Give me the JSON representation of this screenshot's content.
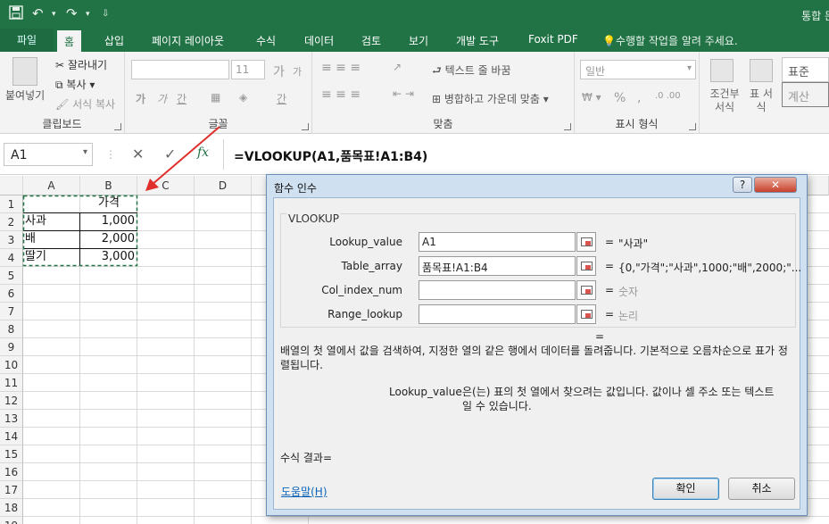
{
  "titlebar": {
    "title": "통합 문",
    "undo_icon": "undo-icon",
    "redo_icon": "redo-icon",
    "save_icon": "save-icon"
  },
  "tabs": {
    "file": "파일",
    "home": "홈",
    "insert": "삽입",
    "page_layout": "페이지 레이아웃",
    "formulas": "수식",
    "data": "데이터",
    "review": "검토",
    "view": "보기",
    "developer": "개발 도구",
    "foxit": "Foxit PDF",
    "tell_me": "수행할 작업을 알려 주세요."
  },
  "ribbon": {
    "clipboard": {
      "paste": "붙여넣기",
      "cut": "잘라내기",
      "copy": "복사",
      "format_painter": "서식 복사",
      "label": "클립보드"
    },
    "font": {
      "size": "11",
      "label": "글꼴",
      "bold": "가",
      "italic": "가",
      "underline": "간",
      "grow": "가",
      "shrink": "가",
      "font_color": "간"
    },
    "alignment": {
      "wrap": "텍스트 줄 바꿈",
      "merge": "병합하고 가운데 맞춤",
      "label": "맞춤"
    },
    "number": {
      "format": "일반",
      "percent": "%",
      "comma": ",",
      "label": "표시 형식"
    },
    "styles": {
      "conditional": "조건부 서식",
      "table": "표 서식",
      "normal": "표준",
      "calc": "계산"
    }
  },
  "formula_bar": {
    "name_box": "A1",
    "cancel": "✕",
    "enter": "✓",
    "fx": "fx",
    "formula": "=VLOOKUP(A1,품목표!A1:B4)"
  },
  "sheet": {
    "columns": [
      "A",
      "B",
      "C",
      "D"
    ],
    "rows": [
      "1",
      "2",
      "3",
      "4",
      "5",
      "6",
      "7",
      "8",
      "9",
      "10",
      "11",
      "12",
      "13",
      "14",
      "15",
      "16",
      "17",
      "18",
      "19"
    ],
    "cells": {
      "B1": "가격",
      "A2": "사과",
      "B2": "1,000",
      "A3": "배",
      "B3": "2,000",
      "A4": "딸기",
      "B4": "3,000"
    }
  },
  "dialog": {
    "title": "함수 인수",
    "help_btn": "?",
    "close_btn": "✕",
    "function": "VLOOKUP",
    "args": [
      {
        "label": "Lookup_value",
        "value": "A1",
        "result": "\"사과\""
      },
      {
        "label": "Table_array",
        "value": "품목표!A1:B4",
        "result": "{0,\"가격\";\"사과\",1000;\"배\",2000;\"..."
      },
      {
        "label": "Col_index_num",
        "value": "",
        "result": "숫자"
      },
      {
        "label": "Range_lookup",
        "value": "",
        "result": "논리"
      }
    ],
    "eq_sign": "=",
    "description": "배열의 첫 열에서 값을 검색하여, 지정한 열의 같은 행에서 데이터를 돌려줍니다. 기본적으로 오름차순으로 표가 정렬됩니다.",
    "arg_help_name": "Lookup_value",
    "arg_help_text": "은(는) 표의 첫 열에서 찾으려는 값입니다. 값이나 셀 주소 또는 텍스트일 수 있습니다.",
    "result_label": "수식 결과=",
    "help_link": "도움말(H)",
    "ok": "확인",
    "cancel": "취소"
  },
  "colors": {
    "excel_green": "#217346",
    "arrow_red": "#e0302c",
    "dialog_blue": "#cfe0f1"
  }
}
